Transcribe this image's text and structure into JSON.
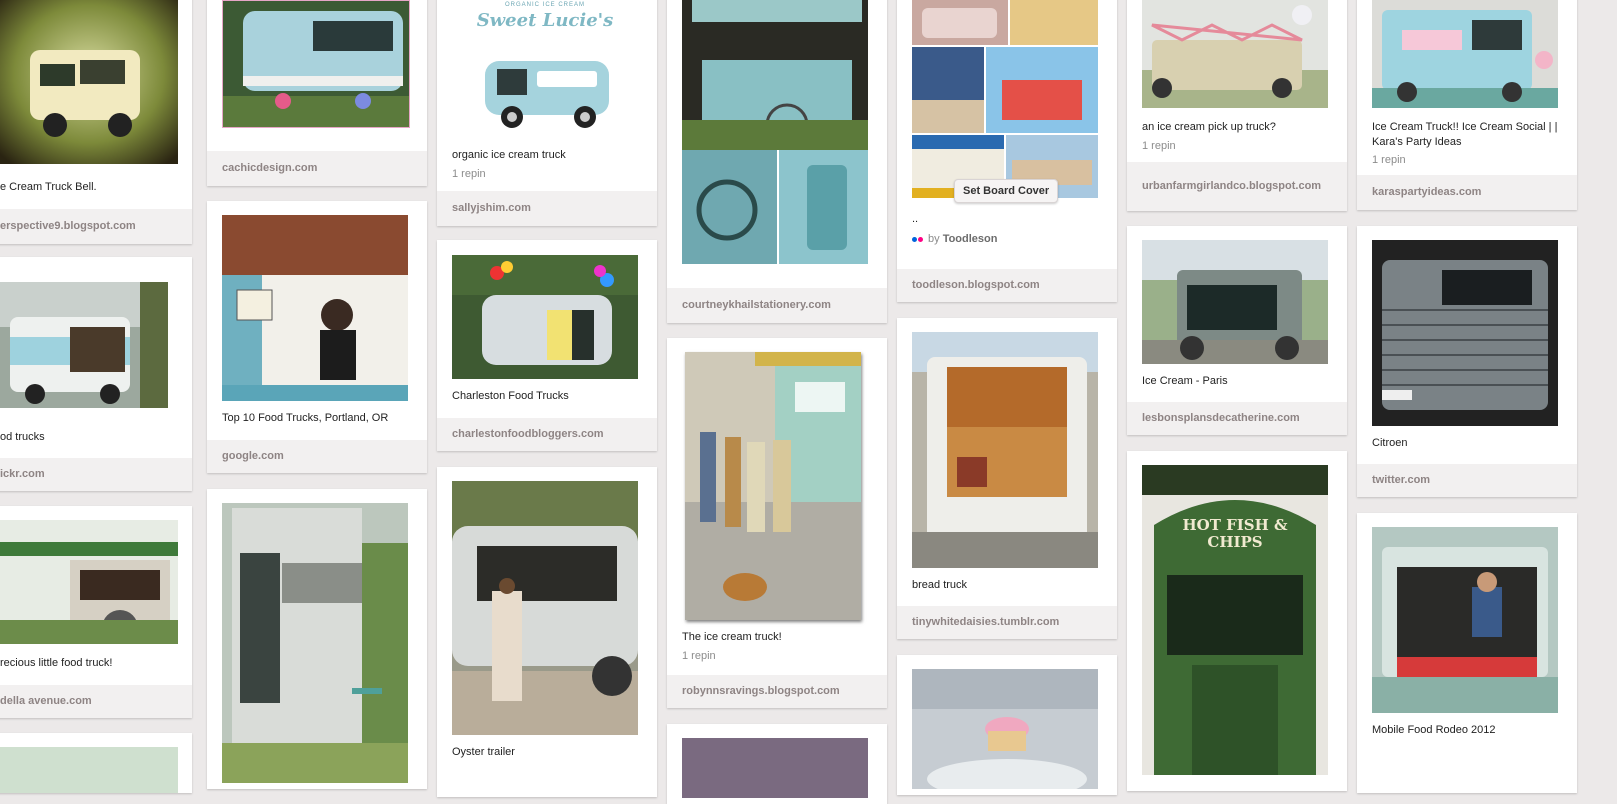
{
  "pins": [
    {
      "id": "c1p1",
      "desc": "e Cream Truck Bell.",
      "source": "erspective9.blogspot.com"
    },
    {
      "id": "c1p2",
      "desc": "od trucks",
      "source": "ickr.com"
    },
    {
      "id": "c1p3",
      "desc": "recious little food truck!",
      "source": "della avenue.com"
    },
    {
      "id": "c2p1",
      "desc": "",
      "source": "cachicdesign.com"
    },
    {
      "id": "c2p2",
      "desc": "Top 10 Food Trucks, Portland, OR",
      "source": "google.com"
    },
    {
      "id": "c2p3",
      "desc": "",
      "source": ""
    },
    {
      "id": "c3p1",
      "desc": "organic ice cream truck",
      "repin": "1 repin",
      "source": "sallyjshim.com"
    },
    {
      "id": "c3p2",
      "desc": "Charleston Food Trucks",
      "source": "charlestonfoodbloggers.com"
    },
    {
      "id": "c3p3",
      "desc": "Oyster trailer",
      "source": ""
    },
    {
      "id": "c4p1",
      "desc": "",
      "source": "courtneykhailstationery.com"
    },
    {
      "id": "c4p2",
      "desc": "The ice cream truck!",
      "repin": "1 repin",
      "source": "robynnsravings.blogspot.com"
    },
    {
      "id": "c5p1",
      "desc": "..",
      "by_prefix": "by",
      "by_name": "Toodleson",
      "source": "toodleson.blogspot.com",
      "set_cover": "Set Board Cover"
    },
    {
      "id": "c5p2",
      "desc": "bread truck",
      "source": "tinywhitedaisies.tumblr.com"
    },
    {
      "id": "c6p1",
      "desc": "an ice cream pick up truck?",
      "repin": "1 repin",
      "source": "urbanfarmgirlandco.blogspot.com"
    },
    {
      "id": "c6p2",
      "desc": "Ice Cream - Paris",
      "source": "lesbonsplansdecatherine.com"
    },
    {
      "id": "c7p1",
      "desc": "Ice Cream Truck!! Ice Cream Social | | Kara's Party Ideas",
      "repin": "1 repin",
      "source": "karaspartyideas.com"
    },
    {
      "id": "c7p2",
      "desc": "Citroen",
      "source": "twitter.com"
    },
    {
      "id": "c7p3",
      "desc": "Mobile Food Rodeo 2012",
      "source": ""
    }
  ],
  "image_text": {
    "sweet_lucies_top": "ORGANIC ICE CREAM",
    "sweet_lucies_logo": "Sweet Lucie's",
    "fish_chips": "HOT FISH & CHIPS"
  },
  "colors": {
    "background": "#ece9e9",
    "source_bar": "#f2f0f0",
    "source_text": "#8e8484"
  }
}
